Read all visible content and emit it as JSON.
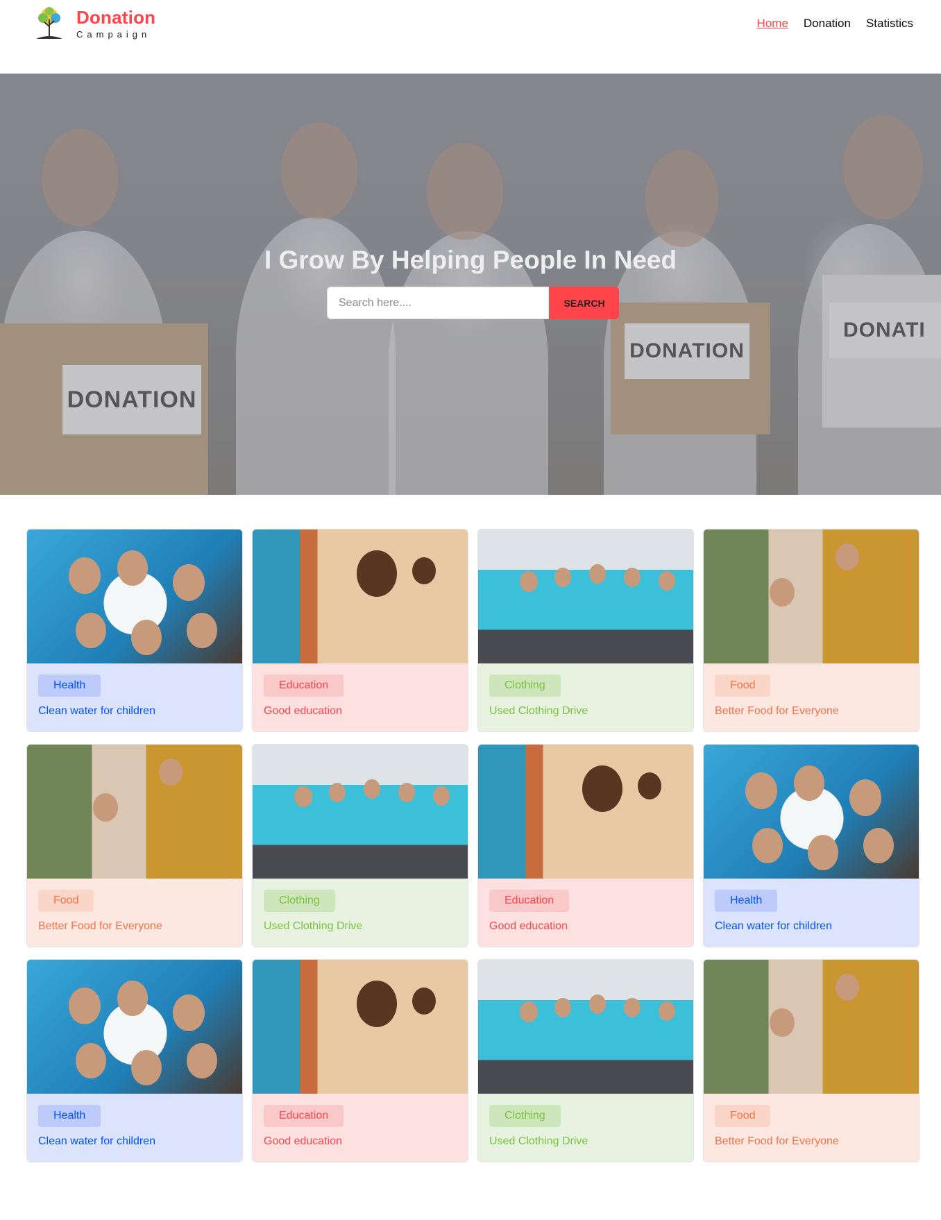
{
  "brand": {
    "title": "Donation",
    "subtitle": "Campaign"
  },
  "nav": {
    "items": [
      {
        "label": "Home",
        "active": true
      },
      {
        "label": "Donation",
        "active": false
      },
      {
        "label": "Statistics",
        "active": false
      }
    ]
  },
  "hero": {
    "title": "I Grow By Helping People In Need",
    "search": {
      "placeholder": "Search here....",
      "button": "SEARCH"
    },
    "box_labels": [
      "DONATION",
      "DONATION",
      "DONATI"
    ]
  },
  "colors": {
    "accent": "#ff444a",
    "health": "#0052ff",
    "education": "#ff444a",
    "clothing": "#79c23f",
    "food": "#f87147"
  },
  "cards": [
    {
      "category": "Health",
      "title": "Clean water for children",
      "theme": "health"
    },
    {
      "category": "Education",
      "title": "Good education",
      "theme": "education"
    },
    {
      "category": "Clothing",
      "title": "Used Clothing Drive",
      "theme": "clothing"
    },
    {
      "category": "Food",
      "title": "Better Food for Everyone",
      "theme": "food"
    },
    {
      "category": "Food",
      "title": "Better Food for Everyone",
      "theme": "food"
    },
    {
      "category": "Clothing",
      "title": "Used Clothing Drive",
      "theme": "clothing"
    },
    {
      "category": "Education",
      "title": "Good education",
      "theme": "education"
    },
    {
      "category": "Health",
      "title": "Clean water for children",
      "theme": "health"
    },
    {
      "category": "Health",
      "title": "Clean water for children",
      "theme": "health"
    },
    {
      "category": "Education",
      "title": "Good education",
      "theme": "education"
    },
    {
      "category": "Clothing",
      "title": "Used Clothing Drive",
      "theme": "clothing"
    },
    {
      "category": "Food",
      "title": "Better Food for Everyone",
      "theme": "food"
    }
  ]
}
